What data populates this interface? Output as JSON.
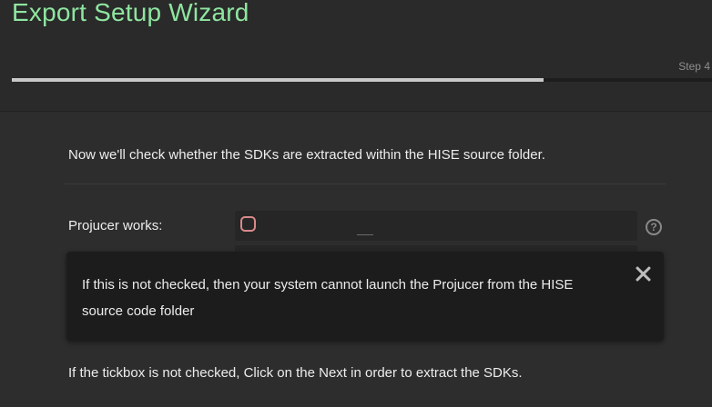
{
  "header": {
    "title": "Export Setup Wizard",
    "step_label": "Step 4",
    "progress_fraction": 0.76,
    "title_color": "#8ee5a0"
  },
  "main": {
    "intro_text": "Now we'll check whether the SDKs are extracted within the HISE source folder.",
    "projucer_label": "Projucer works:",
    "projucer_checked": false,
    "help_icon": "question-mark-circle-icon",
    "tooltip": {
      "text": "If this is not checked, then your system cannot launch the Projucer from the HISE source code folder",
      "close_icon": "close-icon"
    },
    "footer_text": "If the tickbox is not checked, Click on the Next in order to extract the SDKs."
  }
}
